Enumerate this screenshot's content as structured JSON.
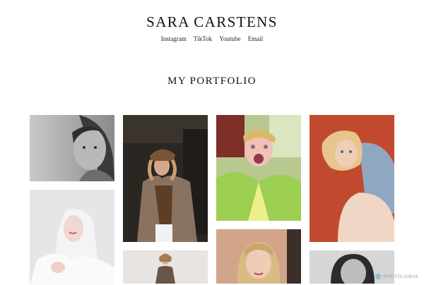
{
  "site": {
    "title": "SARA CARSTENS"
  },
  "nav": {
    "items": [
      {
        "label": "Instagram"
      },
      {
        "label": "TikTok"
      },
      {
        "label": "Youtube"
      },
      {
        "label": "Email"
      }
    ]
  },
  "portfolio": {
    "title": "MY PORTFOLIO"
  },
  "gallery": {
    "items": [
      {
        "name": "photo-woman-bw-portrait",
        "tone": "grayscale"
      },
      {
        "name": "photo-woman-brown-coat",
        "tone": "warm-dark"
      },
      {
        "name": "photo-woman-green-jacket",
        "tone": "vivid-green"
      },
      {
        "name": "photo-woman-denim-red-background",
        "tone": "red"
      },
      {
        "name": "photo-woman-white-hair",
        "tone": "pale"
      },
      {
        "name": "photo-woman-standing-blazer",
        "tone": "neutral"
      },
      {
        "name": "photo-woman-blonde-bob",
        "tone": "peach"
      },
      {
        "name": "photo-woman-bw-slick-hair",
        "tone": "grayscale"
      }
    ]
  },
  "branding": {
    "badge_text": "PORTFOLIOBOX"
  }
}
